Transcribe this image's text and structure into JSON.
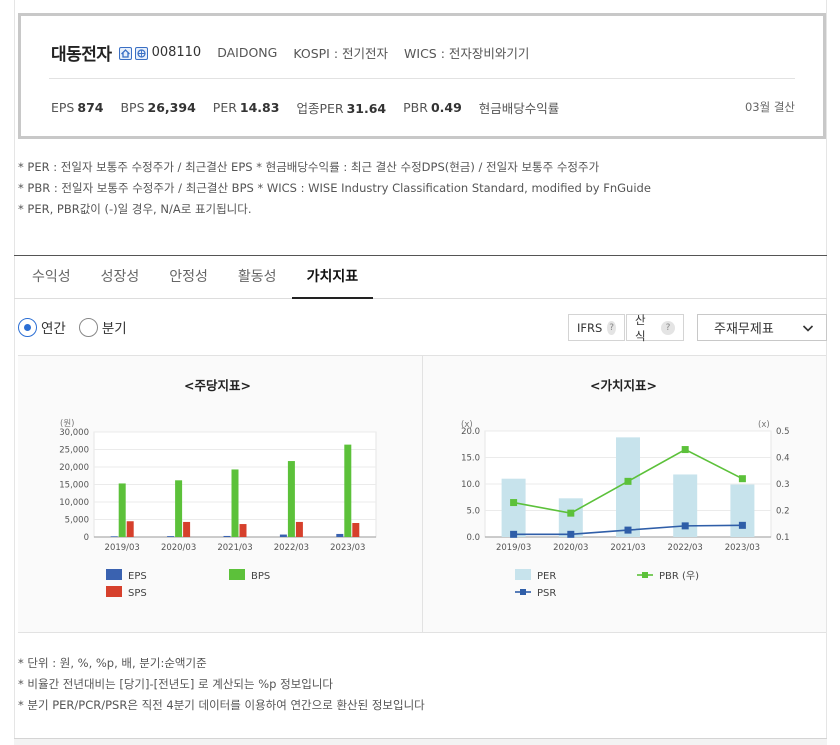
{
  "company": {
    "name": "대동전자",
    "code": "008110",
    "english_name": "DAIDONG",
    "market": "KOSPI : 전기전자",
    "wics": "WICS : 전자장비와기기"
  },
  "metrics": [
    {
      "label": "EPS",
      "value": "874"
    },
    {
      "label": "BPS",
      "value": "26,394"
    },
    {
      "label": "PER",
      "value": "14.83"
    },
    {
      "label": "업종PER",
      "value": "31.64"
    },
    {
      "label": "PBR",
      "value": "0.49"
    },
    {
      "label": "현금배당수익률",
      "value": ""
    }
  ],
  "settlement": "03월 결산",
  "notes_top": [
    "* PER : 전일자 보통주 수정주가 / 최근결산 EPS * 현금배당수익률 : 최근 결산 수정DPS(현금) / 전일자 보통주 수정주가",
    "* PBR : 전일자 보통주 수정주가 / 최근결산 BPS * WICS : WISE Industry Classification Standard, modified by FnGuide",
    "* PER, PBR값이 (-)일 경우, N/A로 표기됩니다."
  ],
  "tabs": [
    "수익성",
    "성장성",
    "안정성",
    "활동성",
    "가치지표"
  ],
  "active_tab": "가치지표",
  "period_options": [
    {
      "label": "연간",
      "checked": true
    },
    {
      "label": "분기",
      "checked": false
    }
  ],
  "controls": {
    "ifrs": "IFRS",
    "formula": "산식",
    "help": "?",
    "statement": "주재무제표"
  },
  "chart_data": [
    {
      "type": "bar",
      "title": "<주당지표>",
      "y_unit_label": "(원)",
      "ylim": [
        0,
        30000
      ],
      "yticks": [
        "0",
        "5,000",
        "10,000",
        "15,000",
        "20,000",
        "25,000",
        "30,000"
      ],
      "categories": [
        "2019/03",
        "2020/03",
        "2021/03",
        "2022/03",
        "2023/03"
      ],
      "series": [
        {
          "name": "EPS",
          "color": "#3a62b0",
          "values": [
            200,
            250,
            300,
            700,
            874
          ]
        },
        {
          "name": "BPS",
          "color": "#5cc13a",
          "values": [
            15300,
            16200,
            19300,
            21700,
            26394
          ]
        },
        {
          "name": "SPS",
          "color": "#d6402c",
          "values": [
            4500,
            4300,
            3700,
            4300,
            4000
          ]
        }
      ],
      "legend_position": "bottom",
      "grid": true
    },
    {
      "type": "bar+line",
      "title": "<가치지표>",
      "left_unit_label": "(x)",
      "right_unit_label": "(x)",
      "left_ylim": [
        0,
        20
      ],
      "left_yticks": [
        "0.0",
        "5.0",
        "10.0",
        "15.0",
        "20.0"
      ],
      "right_ylim": [
        0.1,
        0.5
      ],
      "right_yticks": [
        "0.1",
        "0.2",
        "0.3",
        "0.4",
        "0.5"
      ],
      "categories": [
        "2019/03",
        "2020/03",
        "2021/03",
        "2022/03",
        "2023/03"
      ],
      "series": [
        {
          "name": "PER",
          "kind": "bar",
          "axis": "left",
          "color": "#c7e3ec",
          "values": [
            11.0,
            7.3,
            18.8,
            11.8,
            9.9
          ]
        },
        {
          "name": "PBR (우)",
          "kind": "line",
          "axis": "right",
          "color": "#5cc13a",
          "values": [
            0.23,
            0.19,
            0.31,
            0.43,
            0.32
          ]
        },
        {
          "name": "PSR",
          "kind": "line",
          "axis": "left",
          "color": "#2f5ea8",
          "values": [
            0.5,
            0.5,
            1.3,
            2.1,
            2.2
          ]
        }
      ],
      "legend_position": "bottom",
      "grid": true
    }
  ],
  "notes_bottom": [
    "* 단위 : 원, %, %p, 배, 분기:순액기준",
    "* 비율간 전년대비는 [당기]-[전년도] 로 계산되는 %p 정보입니다",
    "* 분기 PER/PCR/PSR은 직전 4분기 데이터를 이용하여 연간으로 환산된 정보입니다"
  ]
}
